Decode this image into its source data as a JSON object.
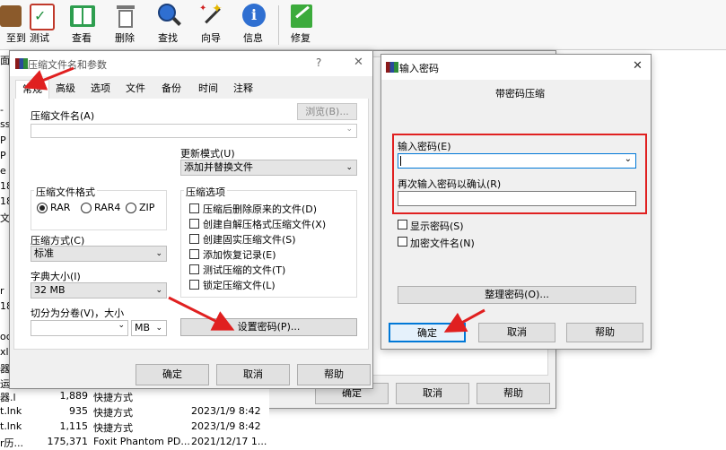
{
  "toolbar": {
    "items": [
      {
        "label": "至到",
        "icon": "add-icon"
      },
      {
        "label": "测试",
        "icon": "test-icon"
      },
      {
        "label": "查看",
        "icon": "view-icon"
      },
      {
        "label": "删除",
        "icon": "delete-icon"
      },
      {
        "label": "查找",
        "icon": "find-icon"
      },
      {
        "label": "向导",
        "icon": "wizard-icon"
      },
      {
        "label": "信息",
        "icon": "info-icon"
      },
      {
        "label": "修复",
        "icon": "repair-icon"
      }
    ]
  },
  "background": {
    "left_fragments": [
      "面",
      "-",
      "ss",
      "P",
      "P",
      "e",
      "18",
      "18",
      "文",
      "r",
      "18",
      "ocx",
      "xls",
      "器",
      "运",
      "器.l"
    ],
    "bg_dialog": {
      "ok_label": "确定",
      "cancel_label": "取消",
      "help_label": "帮助"
    },
    "files": [
      {
        "name": "器.l",
        "size": "1,889",
        "type": "快捷方式",
        "date": ""
      },
      {
        "name": "t.lnk",
        "size": "935",
        "type": "快捷方式",
        "date": "2023/1/9 8:42"
      },
      {
        "name": "t.lnk",
        "size": "1,115",
        "type": "快捷方式",
        "date": "2023/1/9 8:42"
      },
      {
        "name": "r历...",
        "size": "175,371",
        "type": "Foxit Phantom PD...",
        "date": "2021/12/17 1..."
      }
    ]
  },
  "archive_dialog": {
    "title": "压缩文件名和参数",
    "help_glyph": "?",
    "close_glyph": "✕",
    "tabs": [
      "常规",
      "高级",
      "选项",
      "文件",
      "备份",
      "时间",
      "注释"
    ],
    "active_tab": "常规",
    "archive_name_label": "压缩文件名(A)",
    "browse_label": "浏览(B)...",
    "update_mode_label": "更新模式(U)",
    "update_mode_value": "添加并替换文件",
    "format_group": "压缩文件格式",
    "formats": [
      "RAR",
      "RAR4",
      "ZIP"
    ],
    "selected_format": "RAR",
    "method_label": "压缩方式(C)",
    "method_value": "标准",
    "dict_label": "字典大小(I)",
    "dict_value": "32 MB",
    "split_label": "切分为分卷(V)，大小",
    "split_unit": "MB",
    "options_group": "压缩选项",
    "options": [
      "压缩后删除原来的文件(D)",
      "创建自解压格式压缩文件(X)",
      "创建固实压缩文件(S)",
      "添加恢复记录(E)",
      "测试压缩的文件(T)",
      "锁定压缩文件(L)"
    ],
    "set_password_label": "设置密码(P)...",
    "ok_label": "确定",
    "cancel_label": "取消",
    "help_label": "帮助"
  },
  "password_dialog": {
    "title": "输入密码",
    "close_glyph": "✕",
    "subtitle": "带密码压缩",
    "enter_label": "输入密码(E)",
    "confirm_label": "再次输入密码以确认(R)",
    "enter_value": "",
    "confirm_value": "",
    "show_password_label": "显示密码(S)",
    "encrypt_names_label": "加密文件名(N)",
    "organize_label": "整理密码(O)...",
    "ok_label": "确定",
    "cancel_label": "取消",
    "help_label": "帮助"
  },
  "colors": {
    "highlight_red": "#e02020",
    "accent_blue": "#0078d7"
  }
}
